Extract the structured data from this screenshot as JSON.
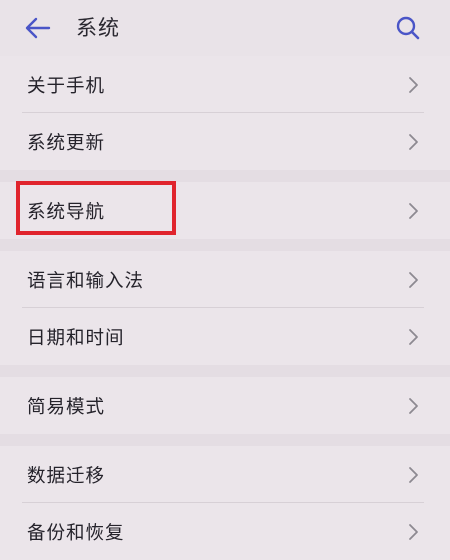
{
  "header": {
    "title": "系统",
    "back_icon": "arrow-left-icon",
    "search_icon": "search-icon",
    "accent_color": "#4a55c7"
  },
  "groups": [
    {
      "items": [
        {
          "label": "关于手机"
        },
        {
          "label": "系统更新"
        }
      ]
    },
    {
      "items": [
        {
          "label": "系统导航",
          "highlighted": true
        }
      ]
    },
    {
      "items": [
        {
          "label": "语言和输入法"
        },
        {
          "label": "日期和时间"
        }
      ]
    },
    {
      "items": [
        {
          "label": "简易模式"
        }
      ]
    },
    {
      "items": [
        {
          "label": "数据迁移"
        },
        {
          "label": "备份和恢复"
        }
      ]
    }
  ],
  "annotation": {
    "highlight_color": "#e0242d"
  }
}
